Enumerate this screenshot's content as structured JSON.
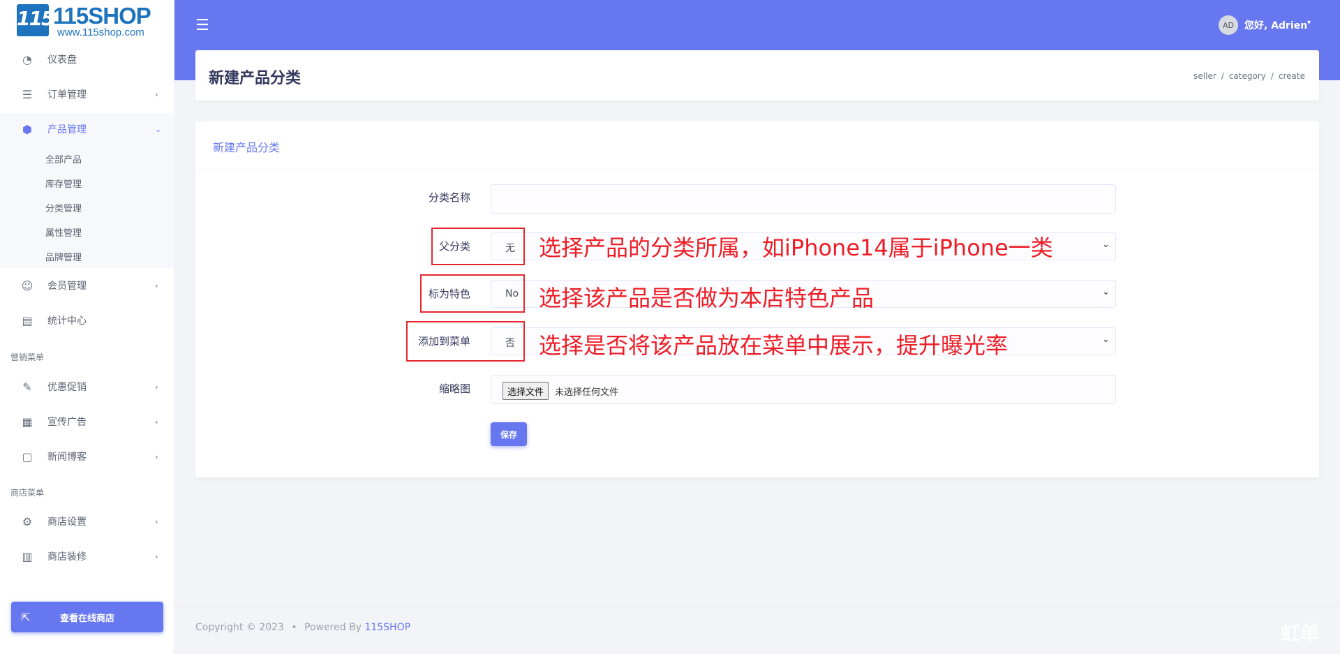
{
  "brand": {
    "logo_mark": "115",
    "name": "115SHOP",
    "url": "www.115shop.com"
  },
  "sidebar": {
    "items": [
      {
        "label": "仪表盘",
        "icon": "dashboard-icon"
      },
      {
        "label": "订单管理",
        "icon": "orders-icon"
      },
      {
        "label": "产品管理",
        "icon": "products-icon"
      },
      {
        "label": "会员管理",
        "icon": "members-icon"
      },
      {
        "label": "统计中心",
        "icon": "stats-icon"
      },
      {
        "label": "优惠促销",
        "icon": "promotion-icon"
      },
      {
        "label": "宣传广告",
        "icon": "ads-icon"
      },
      {
        "label": "新闻博客",
        "icon": "blog-icon"
      },
      {
        "label": "商店设置",
        "icon": "gear-icon"
      },
      {
        "label": "商店装修",
        "icon": "store-icon"
      }
    ],
    "submenu": [
      "全部产品",
      "库存管理",
      "分类管理",
      "属性管理",
      "品牌管理"
    ],
    "sections": [
      "营销菜单",
      "商店菜单"
    ],
    "view_store": "查看在线商店"
  },
  "header": {
    "avatar": "AD",
    "greeting": "您好, Adrien"
  },
  "page": {
    "title": "新建产品分类",
    "breadcrumb": [
      "seller",
      "category",
      "create"
    ]
  },
  "form": {
    "card_title": "新建产品分类",
    "name_label": "分类名称",
    "name_value": "",
    "parent_label": "父分类",
    "parent_value": "无",
    "featured_label": "标为特色",
    "featured_value": "No",
    "menu_label": "添加到菜单",
    "menu_value": "否",
    "thumb_label": "缩略图",
    "file_button": "选择文件",
    "file_none": "未选择任何文件",
    "save": "保存"
  },
  "annotations": {
    "parent": "选择产品的分类所属，如iPhone14属于iPhone一类",
    "featured": "选择该产品是否做为本店特色产品",
    "menu": "选择是否将该产品放在菜单中展示，提升曝光率"
  },
  "footer": {
    "copyright": "Copyright © 2023",
    "bullet": "•",
    "powered": "Powered By",
    "brand": "115SHOP"
  },
  "watermark": "虹单",
  "colors": {
    "accent": "#6777ef",
    "annotation": "#ee1c25"
  }
}
